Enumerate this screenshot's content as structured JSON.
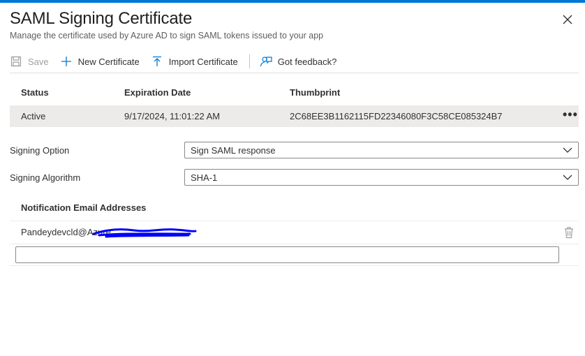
{
  "header": {
    "title": "SAML Signing Certificate",
    "subtitle": "Manage the certificate used by Azure AD to sign SAML tokens issued to your app"
  },
  "toolbar": {
    "save_label": "Save",
    "new_certificate_label": "New Certificate",
    "import_certificate_label": "Import Certificate",
    "feedback_label": "Got feedback?"
  },
  "table": {
    "columns": [
      "Status",
      "Expiration Date",
      "Thumbprint"
    ],
    "rows": [
      {
        "status": "Active",
        "expiration": "9/17/2024, 11:01:22 AM",
        "thumbprint": "2C68EE3B1162115FD22346080F3C58CE085324B7",
        "more": "•••"
      }
    ]
  },
  "signing": {
    "option_label": "Signing Option",
    "option_value": "Sign SAML response",
    "algorithm_label": "Signing Algorithm",
    "algorithm_value": "SHA-1"
  },
  "notifications": {
    "heading": "Notification Email Addresses",
    "emails": [
      "Pandeydevcld@Azure"
    ],
    "new_email_value": ""
  },
  "colors": {
    "accent": "#0078d4",
    "row_selected": "#edebe9",
    "redaction": "#0000ff"
  }
}
